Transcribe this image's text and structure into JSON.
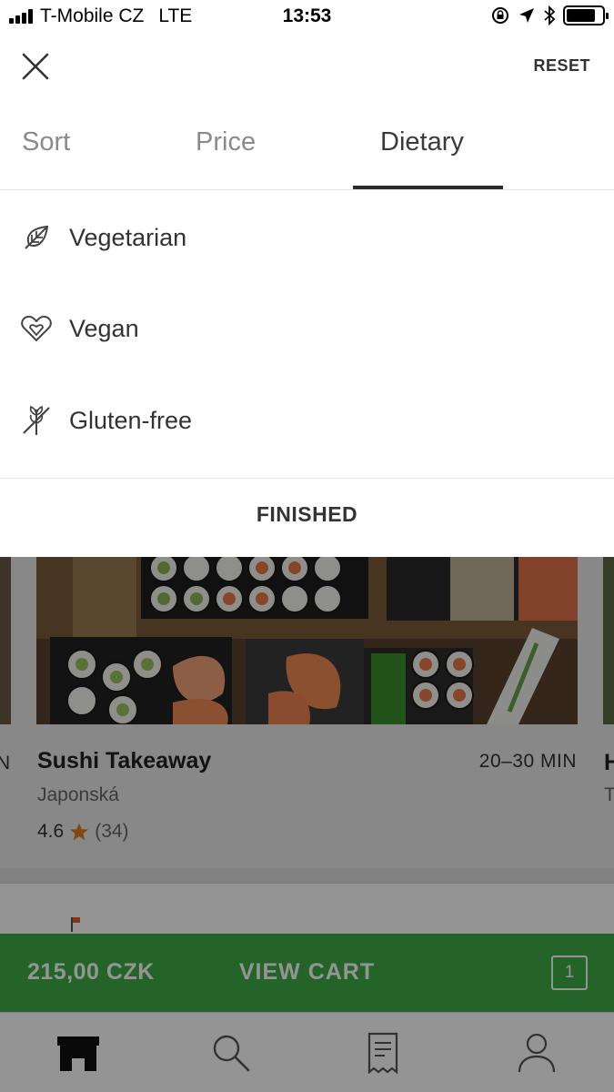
{
  "status_bar": {
    "carrier": "T-Mobile CZ",
    "network": "LTE",
    "time": "13:53"
  },
  "header": {
    "reset_label": "RESET"
  },
  "tabs": [
    {
      "label": "Sort",
      "active": false
    },
    {
      "label": "Price",
      "active": false
    },
    {
      "label": "Dietary",
      "active": true
    }
  ],
  "dietary_options": [
    {
      "label": "Vegetarian",
      "icon": "leaf-icon"
    },
    {
      "label": "Vegan",
      "icon": "heart-leaf-icon"
    },
    {
      "label": "Gluten-free",
      "icon": "gluten-free-icon"
    }
  ],
  "finished_label": "FINISHED",
  "restaurant": {
    "name": "Sushi Takeaway",
    "delivery_time": "20–30 MIN",
    "cuisine": "Japonská",
    "rating": "4.6",
    "rating_count": "(34)"
  },
  "edge_text": {
    "left": "N",
    "right_name": "H",
    "right_sub": "T"
  },
  "cart": {
    "price": "215,00 CZK",
    "label": "VIEW CART",
    "count": "1"
  },
  "bottom_nav": [
    "store-icon",
    "search-icon",
    "receipt-icon",
    "profile-icon"
  ],
  "colors": {
    "accent_green": "#3ead46",
    "star": "#e07b1f"
  }
}
